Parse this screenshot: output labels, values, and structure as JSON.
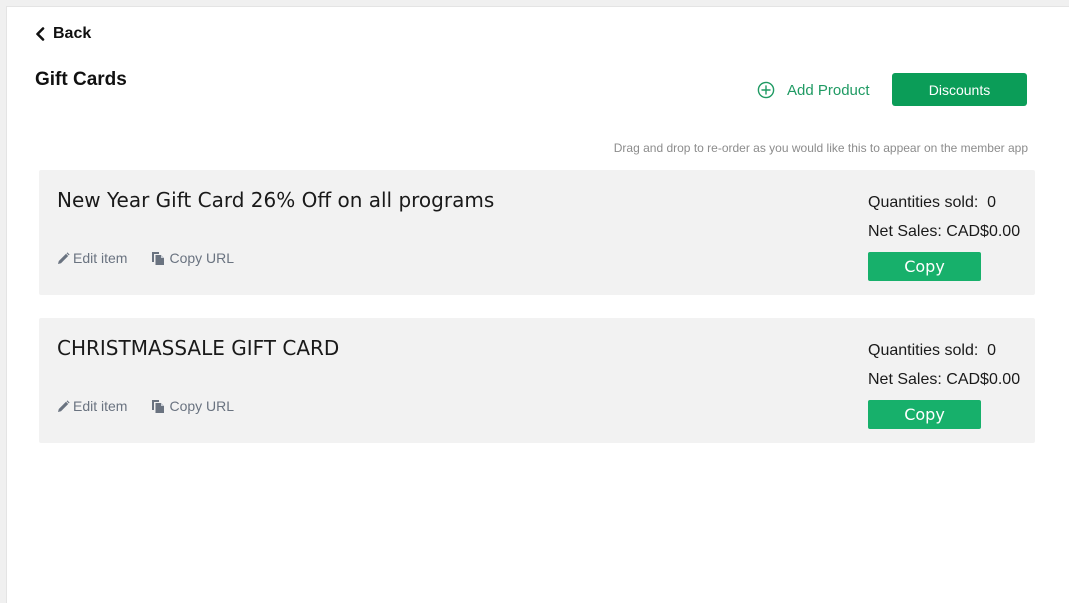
{
  "nav": {
    "back_label": "Back"
  },
  "page": {
    "title": "Gift Cards"
  },
  "toolbar": {
    "add_product_label": "Add Product",
    "discounts_label": "Discounts"
  },
  "hint": "Drag and drop to re-order as you would like this to appear on the member app",
  "colors": {
    "accent": "#0b9d58",
    "copy_button": "#17b06b",
    "link_green": "#1f9a63",
    "card_bg": "#f2f2f2"
  },
  "icons": {
    "back": "chevron-left-icon",
    "add_product": "plus-circle-icon",
    "edit": "pencil-icon",
    "copy_url": "copy-icon"
  },
  "products": [
    {
      "title": "New Year Gift Card 26% Off on all programs",
      "edit_label": "Edit item",
      "copy_url_label": "Copy URL",
      "quantities_label": "Quantities sold:",
      "quantities_value": "0",
      "net_sales_label": "Net Sales:",
      "net_sales_value": "CAD$0.00",
      "copy_label": "Copy"
    },
    {
      "title": "CHRISTMASSALE GIFT CARD",
      "edit_label": "Edit item",
      "copy_url_label": "Copy URL",
      "quantities_label": "Quantities sold:",
      "quantities_value": "0",
      "net_sales_label": "Net Sales:",
      "net_sales_value": "CAD$0.00",
      "copy_label": "Copy"
    }
  ]
}
